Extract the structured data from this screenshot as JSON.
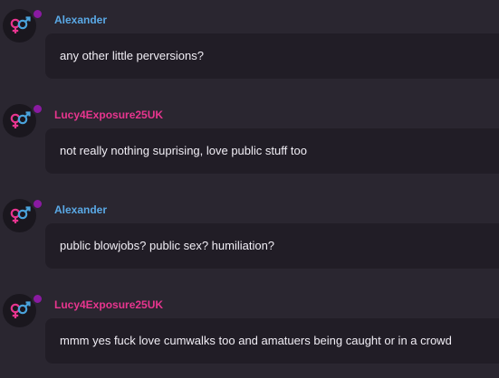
{
  "colors": {
    "background": "#2a2630",
    "bubble": "#211d26",
    "user_alexander": "#5aa9e6",
    "user_lucy": "#e8358f",
    "status_dot": "#8a1aa2"
  },
  "messages": [
    {
      "username": "Alexander",
      "user_color": "#5aa9e6",
      "avatar_icon": "gender-symbols-icon",
      "text": "any other little perversions?"
    },
    {
      "username": "Lucy4Exposure25UK",
      "user_color": "#e8358f",
      "avatar_icon": "gender-symbols-icon",
      "text": "not really nothing suprising, love public stuff too"
    },
    {
      "username": "Alexander",
      "user_color": "#5aa9e6",
      "avatar_icon": "gender-symbols-icon",
      "text": "public blowjobs? public sex? humiliation?"
    },
    {
      "username": "Lucy4Exposure25UK",
      "user_color": "#e8358f",
      "avatar_icon": "gender-symbols-icon",
      "text": "mmm yes fuck love cumwalks too and amatuers being caught or in a crowd"
    }
  ]
}
